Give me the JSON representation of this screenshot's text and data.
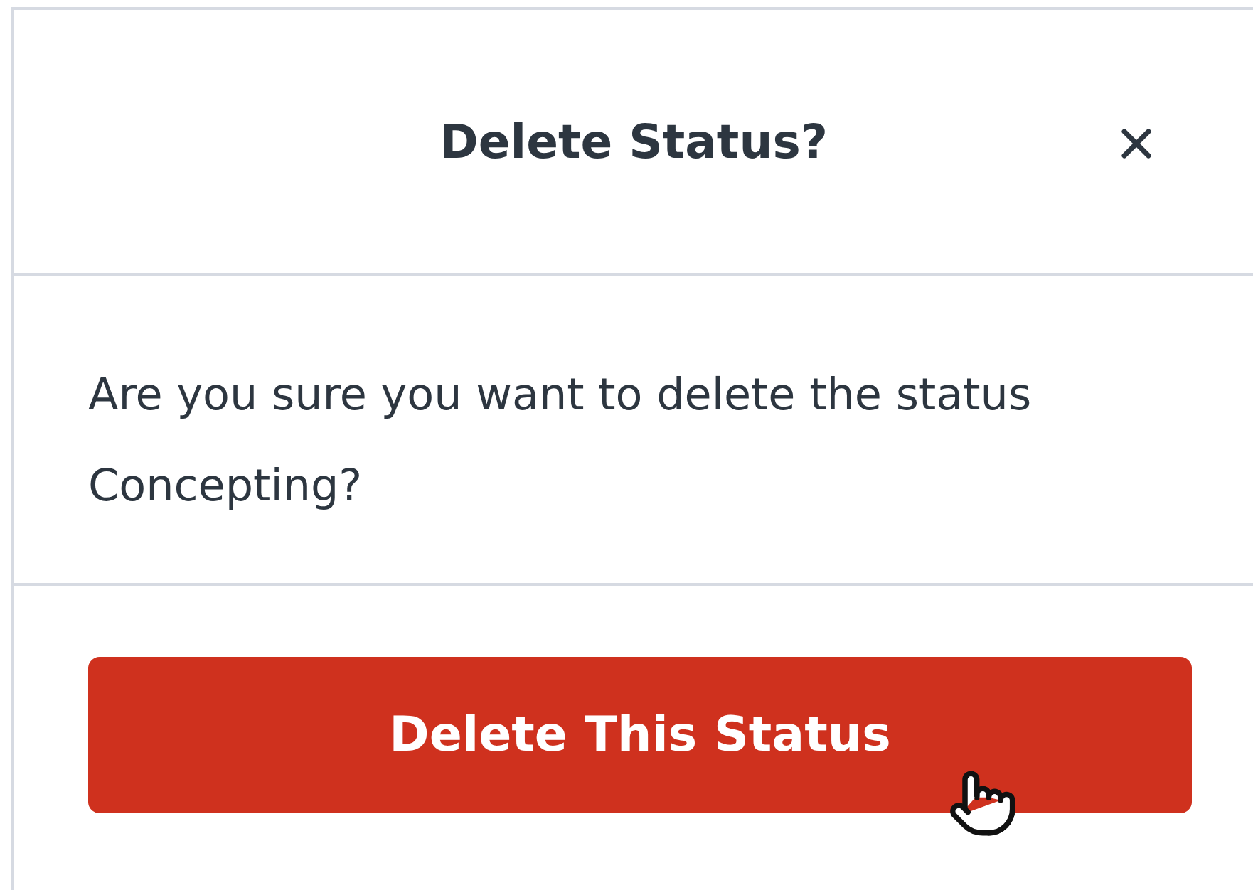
{
  "dialog": {
    "title": "Delete Status?",
    "message": "Are you sure you want to delete the status Concepting?",
    "confirm_button": "Delete This Status"
  }
}
